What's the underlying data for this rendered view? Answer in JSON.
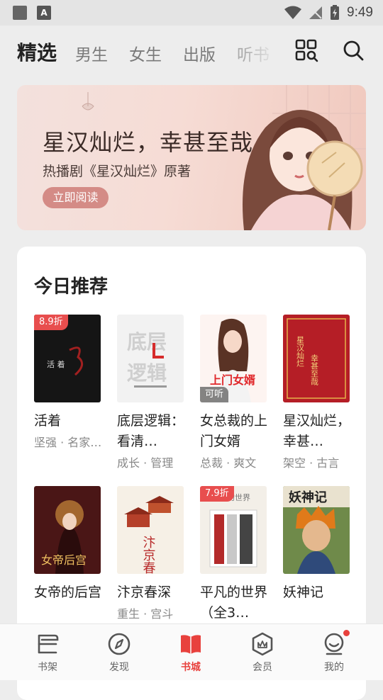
{
  "status_bar": {
    "time": "9:49"
  },
  "top_tabs": [
    {
      "label": "精选"
    },
    {
      "label": "男生"
    },
    {
      "label": "女生"
    },
    {
      "label": "出版"
    },
    {
      "label": "听书"
    }
  ],
  "banner": {
    "title": "星汉灿烂，幸甚至哉",
    "subtitle": "热播剧《星汉灿烂》原著",
    "button": "立即阅读"
  },
  "section": {
    "title": "今日推荐",
    "books": [
      {
        "title": "活着",
        "tags": "坚强 · 名家…",
        "badge": "8.9折"
      },
      {
        "title": "底层逻辑：看清…",
        "tags": "成长 · 管理"
      },
      {
        "title": "女总裁的上门女婿",
        "tags": "总裁 · 爽文",
        "badge": "可听"
      },
      {
        "title": "星汉灿烂，幸甚…",
        "tags": "架空 · 古言"
      },
      {
        "title": "女帝的后宫",
        "tags": ""
      },
      {
        "title": "汴京春深",
        "tags": "重生 · 宫斗"
      },
      {
        "title": "平凡的世界（全3…",
        "tags": "",
        "badge": "7.9折"
      },
      {
        "title": "妖神记",
        "tags": ""
      }
    ]
  },
  "bottom_nav": [
    {
      "label": "书架",
      "icon": "bookshelf-icon"
    },
    {
      "label": "发现",
      "icon": "compass-icon"
    },
    {
      "label": "书城",
      "icon": "bookstore-icon"
    },
    {
      "label": "会员",
      "icon": "vip-icon"
    },
    {
      "label": "我的",
      "icon": "profile-icon"
    }
  ],
  "colors": {
    "accent": "#e8413d",
    "banner_button": "#d48b86"
  }
}
